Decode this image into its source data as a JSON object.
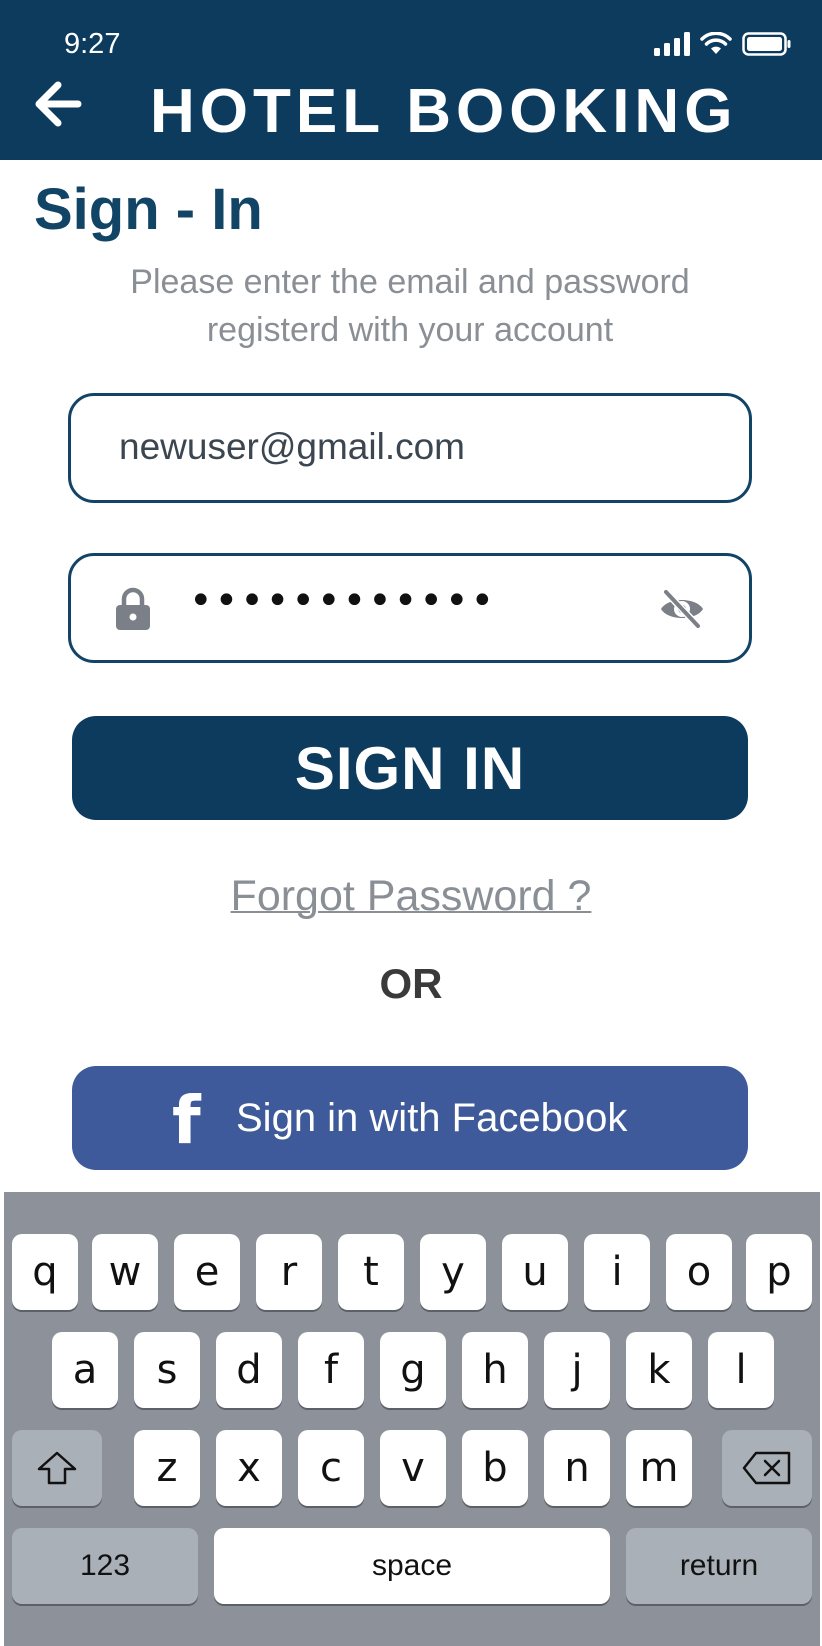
{
  "status_bar": {
    "time": "9:27"
  },
  "header": {
    "title": "HOTEL BOOKING"
  },
  "page": {
    "title": "Sign - In",
    "subtitle_line1": "Please enter the email and password",
    "subtitle_line2": "registerd with your account"
  },
  "form": {
    "email_value": "newuser@gmail.com",
    "password_masked": "••••••••••••",
    "signin_label": "SIGN IN",
    "forgot_label": "Forgot Password ?",
    "or_label": "OR",
    "facebook_label": "Sign in with Facebook",
    "facebook_icon_glyph": "f"
  },
  "keyboard": {
    "row1": [
      "q",
      "w",
      "e",
      "r",
      "t",
      "y",
      "u",
      "i",
      "o",
      "p"
    ],
    "row2": [
      "a",
      "s",
      "d",
      "f",
      "g",
      "h",
      "j",
      "k",
      "l"
    ],
    "row3": [
      "z",
      "x",
      "c",
      "v",
      "b",
      "n",
      "m"
    ],
    "numbers_label": "123",
    "space_label": "space",
    "return_label": "return"
  },
  "colors": {
    "header_bg": "#0d3b5e",
    "primary": "#0d3b5e",
    "facebook": "#3e5a9a",
    "muted_text": "#8a8f96",
    "keyboard_bg": "#8d929a"
  },
  "icons": [
    "back-arrow-icon",
    "cellular-signal-icon",
    "wifi-icon",
    "battery-icon",
    "lock-icon",
    "eye-off-icon",
    "facebook-icon",
    "shift-icon",
    "backspace-icon"
  ]
}
